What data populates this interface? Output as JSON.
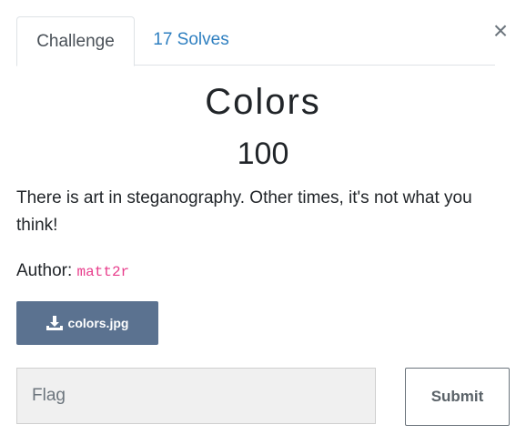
{
  "tabs": [
    {
      "label": "Challenge",
      "active": true
    },
    {
      "label": "17 Solves",
      "active": false
    }
  ],
  "close_symbol": "×",
  "challenge": {
    "name": "Colors",
    "value": "100",
    "description": "There is art in steganography. Other times, it's not what you think!",
    "author_label": "Author:",
    "author": "matt2r"
  },
  "download": {
    "icon": "download-icon",
    "label": "colors.jpg"
  },
  "form": {
    "flag_placeholder": "Flag",
    "submit_label": "Submit"
  },
  "colors": {
    "link": "#2e7fc0",
    "download_bg": "#5b7290",
    "author_code": "#e83e8c"
  }
}
